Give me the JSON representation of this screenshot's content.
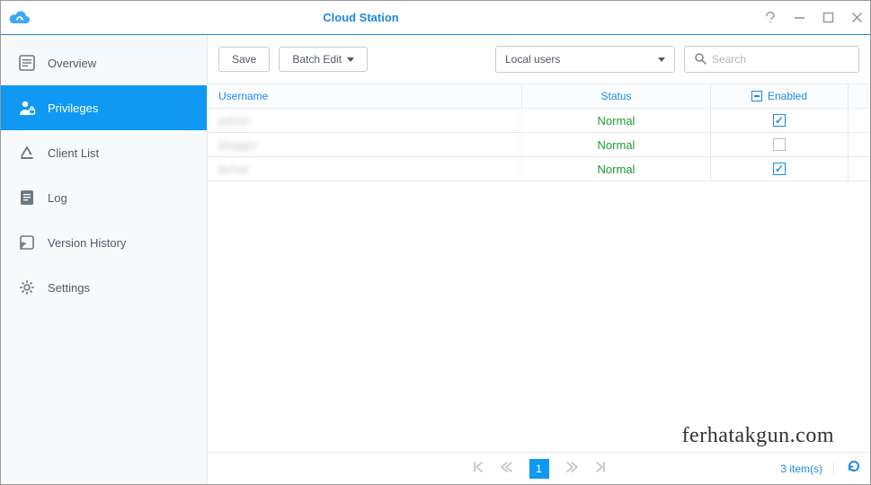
{
  "window": {
    "title": "Cloud Station"
  },
  "sidebar": {
    "items": [
      {
        "label": "Overview"
      },
      {
        "label": "Privileges"
      },
      {
        "label": "Client List"
      },
      {
        "label": "Log"
      },
      {
        "label": "Version History"
      },
      {
        "label": "Settings"
      }
    ]
  },
  "toolbar": {
    "save_label": "Save",
    "batch_edit_label": "Batch Edit",
    "user_type_selected": "Local users"
  },
  "search": {
    "placeholder": "Search"
  },
  "table": {
    "columns": {
      "username": "Username",
      "status": "Status",
      "enabled": "Enabled"
    },
    "rows": [
      {
        "username": "admin",
        "status": "Normal",
        "enabled": true
      },
      {
        "username": "blogger",
        "status": "Normal",
        "enabled": false
      },
      {
        "username": "ferhat",
        "status": "Normal",
        "enabled": true
      }
    ]
  },
  "paginator": {
    "page": "1",
    "count_text": "3 item(s)"
  },
  "watermark": "ferhatakgun.com"
}
